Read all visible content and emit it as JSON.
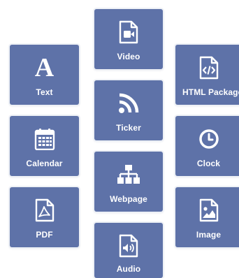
{
  "tiles": {
    "text": {
      "label": "Text",
      "icon": "letter-a-icon"
    },
    "calendar": {
      "label": "Calendar",
      "icon": "calendar-icon"
    },
    "pdf": {
      "label": "PDF",
      "icon": "pdf-file-icon"
    },
    "video": {
      "label": "Video",
      "icon": "video-file-icon"
    },
    "ticker": {
      "label": "Ticker",
      "icon": "rss-icon"
    },
    "webpage": {
      "label": "Webpage",
      "icon": "sitemap-icon"
    },
    "audio": {
      "label": "Audio",
      "icon": "audio-file-icon"
    },
    "html": {
      "label": "HTML Package",
      "icon": "code-file-icon"
    },
    "clock": {
      "label": "Clock",
      "icon": "clock-icon"
    },
    "image": {
      "label": "Image",
      "icon": "image-file-icon"
    }
  },
  "icon_glyphs": {
    "text": "A"
  },
  "colors": {
    "tile_background": "#5e72a8",
    "tile_foreground": "#ffffff",
    "page_background": "#ffffff"
  }
}
